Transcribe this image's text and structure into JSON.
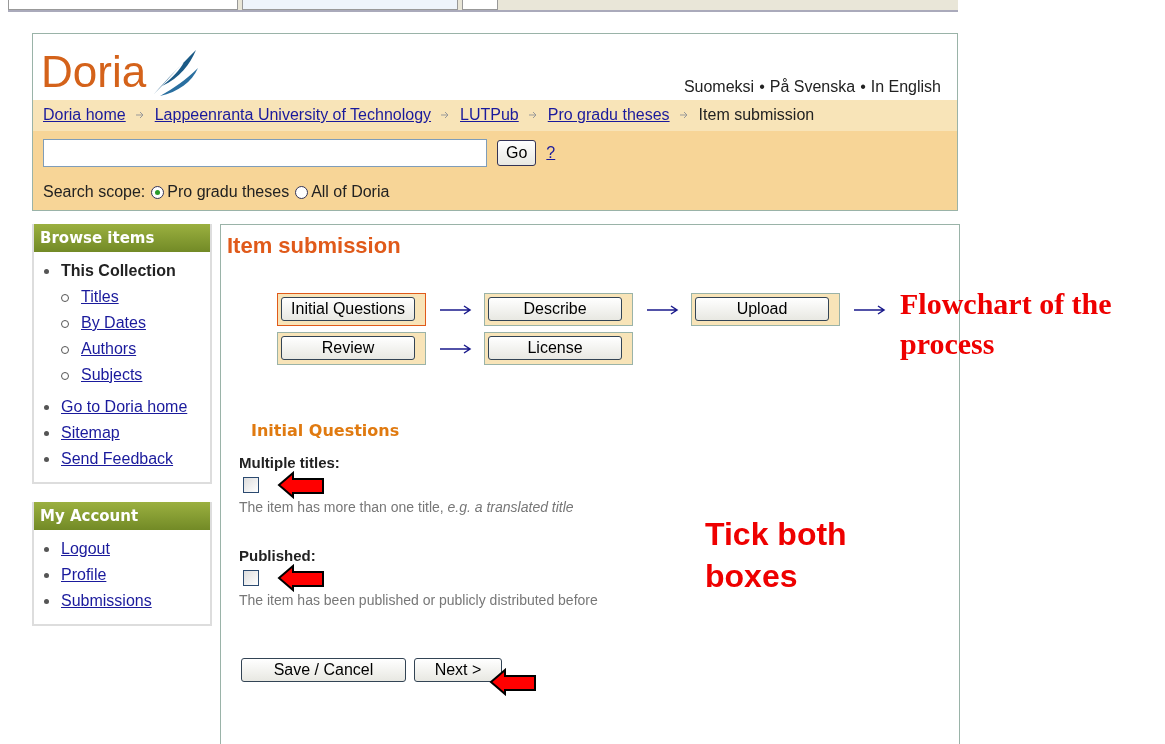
{
  "header": {
    "logo": "Doria",
    "languages": [
      "Suomeksi",
      "På Svenska",
      "In English"
    ],
    "language_separator": "•"
  },
  "breadcrumbs": [
    {
      "label": "Doria home",
      "link": true
    },
    {
      "label": "Lappeenranta University of Technology",
      "link": true
    },
    {
      "label": "LUTPub ",
      "link": true
    },
    {
      "label": "Pro gradu theses",
      "link": true
    },
    {
      "label": "Item submission",
      "link": false
    }
  ],
  "search": {
    "button": "Go",
    "help": "?",
    "scope_label": "Search scope:",
    "scopes": [
      {
        "label": "Pro gradu theses",
        "selected": true
      },
      {
        "label": "All of Doria",
        "selected": false
      }
    ]
  },
  "sidebar": [
    {
      "title": "Browse items",
      "items": [
        {
          "label": "This Collection",
          "link": false,
          "children": [
            {
              "label": "Titles",
              "link": true
            },
            {
              "label": "By Dates",
              "link": true
            },
            {
              "label": "Authors",
              "link": true
            },
            {
              "label": "Subjects",
              "link": true
            }
          ]
        },
        {
          "label": "Go to Doria home",
          "link": true
        },
        {
          "label": "Sitemap",
          "link": true
        },
        {
          "label": "Send Feedback",
          "link": true
        }
      ]
    },
    {
      "title": "My Account",
      "items": [
        {
          "label": "Logout",
          "link": true
        },
        {
          "label": "Profile",
          "link": true
        },
        {
          "label": "Submissions",
          "link": true
        }
      ]
    }
  ],
  "main": {
    "title": "Item submission",
    "steps": [
      [
        {
          "label": "Initial Questions",
          "selected": true,
          "arrow": true
        },
        {
          "label": "Describe",
          "selected": false,
          "arrow": true
        },
        {
          "label": "Upload",
          "selected": false,
          "arrow": true
        }
      ],
      [
        {
          "label": "Review",
          "selected": false,
          "arrow": true
        },
        {
          "label": "License",
          "selected": false,
          "arrow": false
        }
      ]
    ],
    "section": "Initial Questions",
    "questions": [
      {
        "label": "Multiple titles:",
        "checked": false,
        "hint": "The item has more than one title, *e.g. a translated title*"
      },
      {
        "label": "Published:",
        "checked": false,
        "hint": "The item has been published or publicly distributed before"
      }
    ],
    "buttons": [
      "Save / Cancel",
      "Next >"
    ]
  },
  "annotations": [
    {
      "text": "Flowchart of the process",
      "kind": "serif"
    },
    {
      "text": "Tick both boxes",
      "kind": "sans"
    }
  ]
}
